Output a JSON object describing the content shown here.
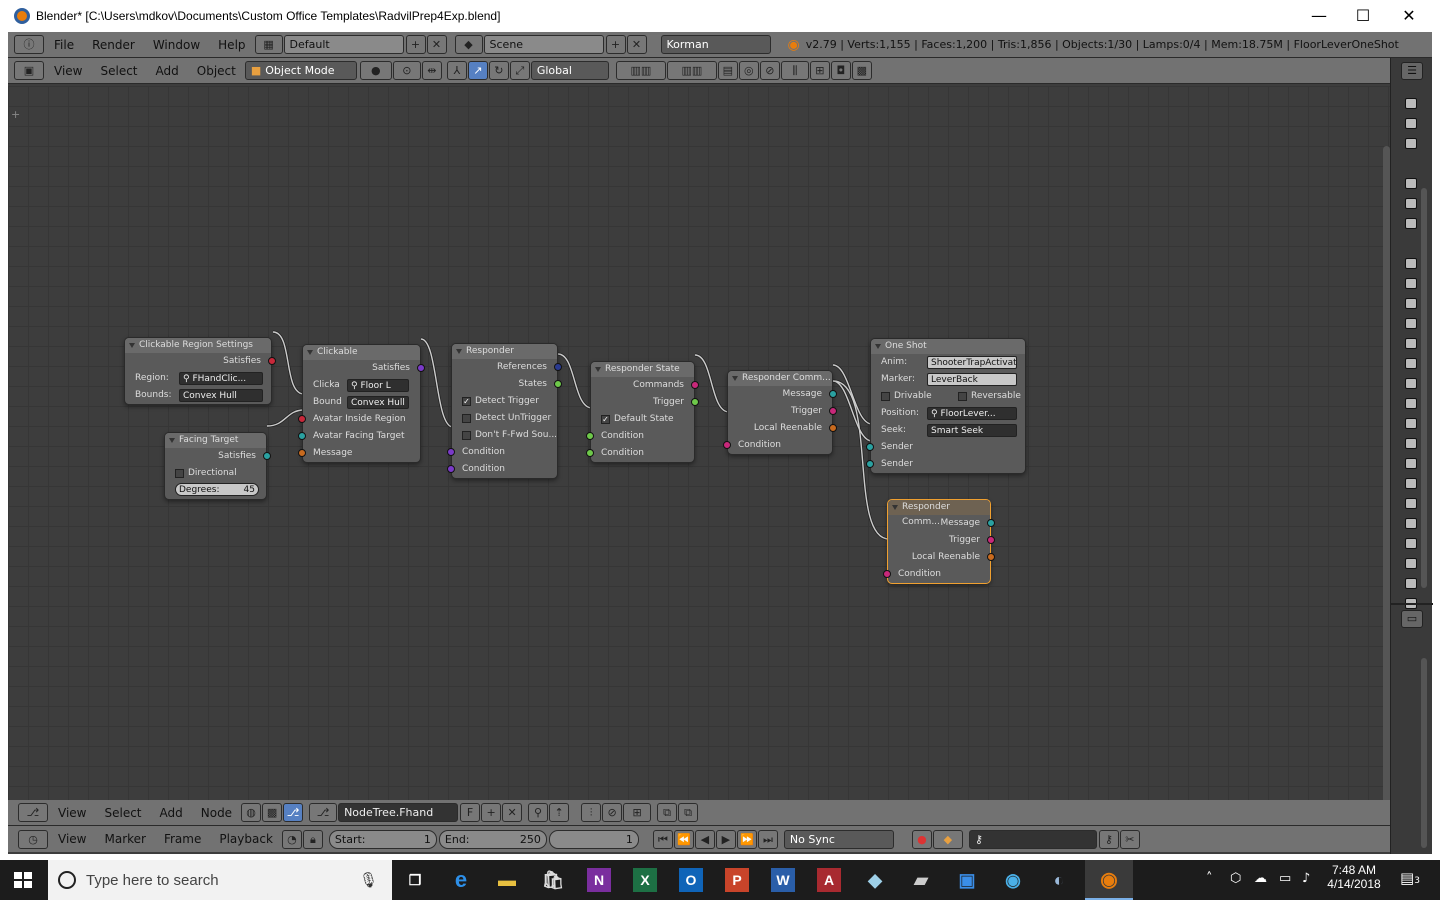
{
  "window": {
    "title": "Blender* [C:\\Users\\mdkov\\Documents\\Custom Office Templates\\RadvilPrep4Exp.blend]",
    "minimize": "—",
    "maximize": "☐",
    "close": "✕"
  },
  "info_header": {
    "menus": [
      "File",
      "Render",
      "Window",
      "Help"
    ],
    "screen": "Default",
    "scene": "Scene",
    "engine": "Korman",
    "stats": "v2.79 | Verts:1,155 | Faces:1,200 | Tris:1,856 | Objects:1/30 | Lamps:0/4 | Mem:18.75M | FloorLeverOneShot"
  },
  "view3d_header": {
    "menus": [
      "View",
      "Select",
      "Add",
      "Object"
    ],
    "mode": "Object Mode",
    "orientation": "Global"
  },
  "nodes": {
    "clickable_region": {
      "title": "Clickable Region Settings",
      "satisfies": "Satisfies",
      "region_label": "Region:",
      "region_value": "FHandClic...",
      "bounds_label": "Bounds:",
      "bounds_value": "Convex Hull"
    },
    "facing_target": {
      "title": "Facing Target",
      "satisfies": "Satisfies",
      "directional": "Directional",
      "degrees_label": "Degrees:",
      "degrees_value": "45"
    },
    "clickable": {
      "title": "Clickable",
      "satisfies": "Satisfies",
      "clicka_label": "Clicka",
      "clicka_value": "Floor L",
      "bound_label": "Bound",
      "bound_value": "Convex Hull",
      "in1": "Avatar Inside Region",
      "in2": "Avatar Facing Target",
      "in3": "Message"
    },
    "responder": {
      "title": "Responder",
      "references": "References",
      "states": "States",
      "detect_trigger": "Detect Trigger",
      "detect_untrigger": "Detect UnTrigger",
      "dont_ffwd": "Don't F-Fwd Sou...",
      "cond1": "Condition",
      "cond2": "Condition"
    },
    "responder_state": {
      "title": "Responder State",
      "commands": "Commands",
      "trigger": "Trigger",
      "default_state": "Default State",
      "cond1": "Condition",
      "cond2": "Condition"
    },
    "responder_command1": {
      "title": "Responder Comm...",
      "message": "Message",
      "trigger": "Trigger",
      "local_reenable": "Local Reenable",
      "condition": "Condition"
    },
    "one_shot": {
      "title": "One Shot",
      "anim_label": "Anim:",
      "anim_value": "ShooterTrapActivate",
      "marker_label": "Marker:",
      "marker_value": "LeverBack",
      "drivable": "Drivable",
      "reversable": "Reversable",
      "position_label": "Position:",
      "position_value": "FloorLever...",
      "seek_label": "Seek:",
      "seek_value": "Smart Seek",
      "sender1": "Sender",
      "sender2": "Sender"
    },
    "responder_command2": {
      "title": "Responder Comm...",
      "message": "Message",
      "trigger": "Trigger",
      "local_reenable": "Local Reenable",
      "condition": "Condition"
    }
  },
  "node_header": {
    "menus": [
      "View",
      "Select",
      "Add",
      "Node"
    ],
    "tree": "NodeTree.Fhand",
    "fake": "F"
  },
  "timeline_header": {
    "menus": [
      "View",
      "Marker",
      "Frame",
      "Playback"
    ],
    "start_label": "Start:",
    "start_value": "1",
    "end_label": "End:",
    "end_value": "250",
    "current_frame": "1",
    "sync": "No Sync"
  },
  "taskbar": {
    "search_placeholder": "Type here to search",
    "time": "7:48 AM",
    "date": "4/14/2018",
    "notifications": "3"
  },
  "colors": {
    "socket_red": "#c8283a",
    "socket_teal": "#2aa1a1",
    "socket_orange": "#c86a1e",
    "socket_green": "#6ec84a",
    "socket_purple": "#7a3ac8",
    "socket_blue": "#2a3a90",
    "socket_magenta": "#c8287a",
    "selected_border": "#f0a030"
  }
}
